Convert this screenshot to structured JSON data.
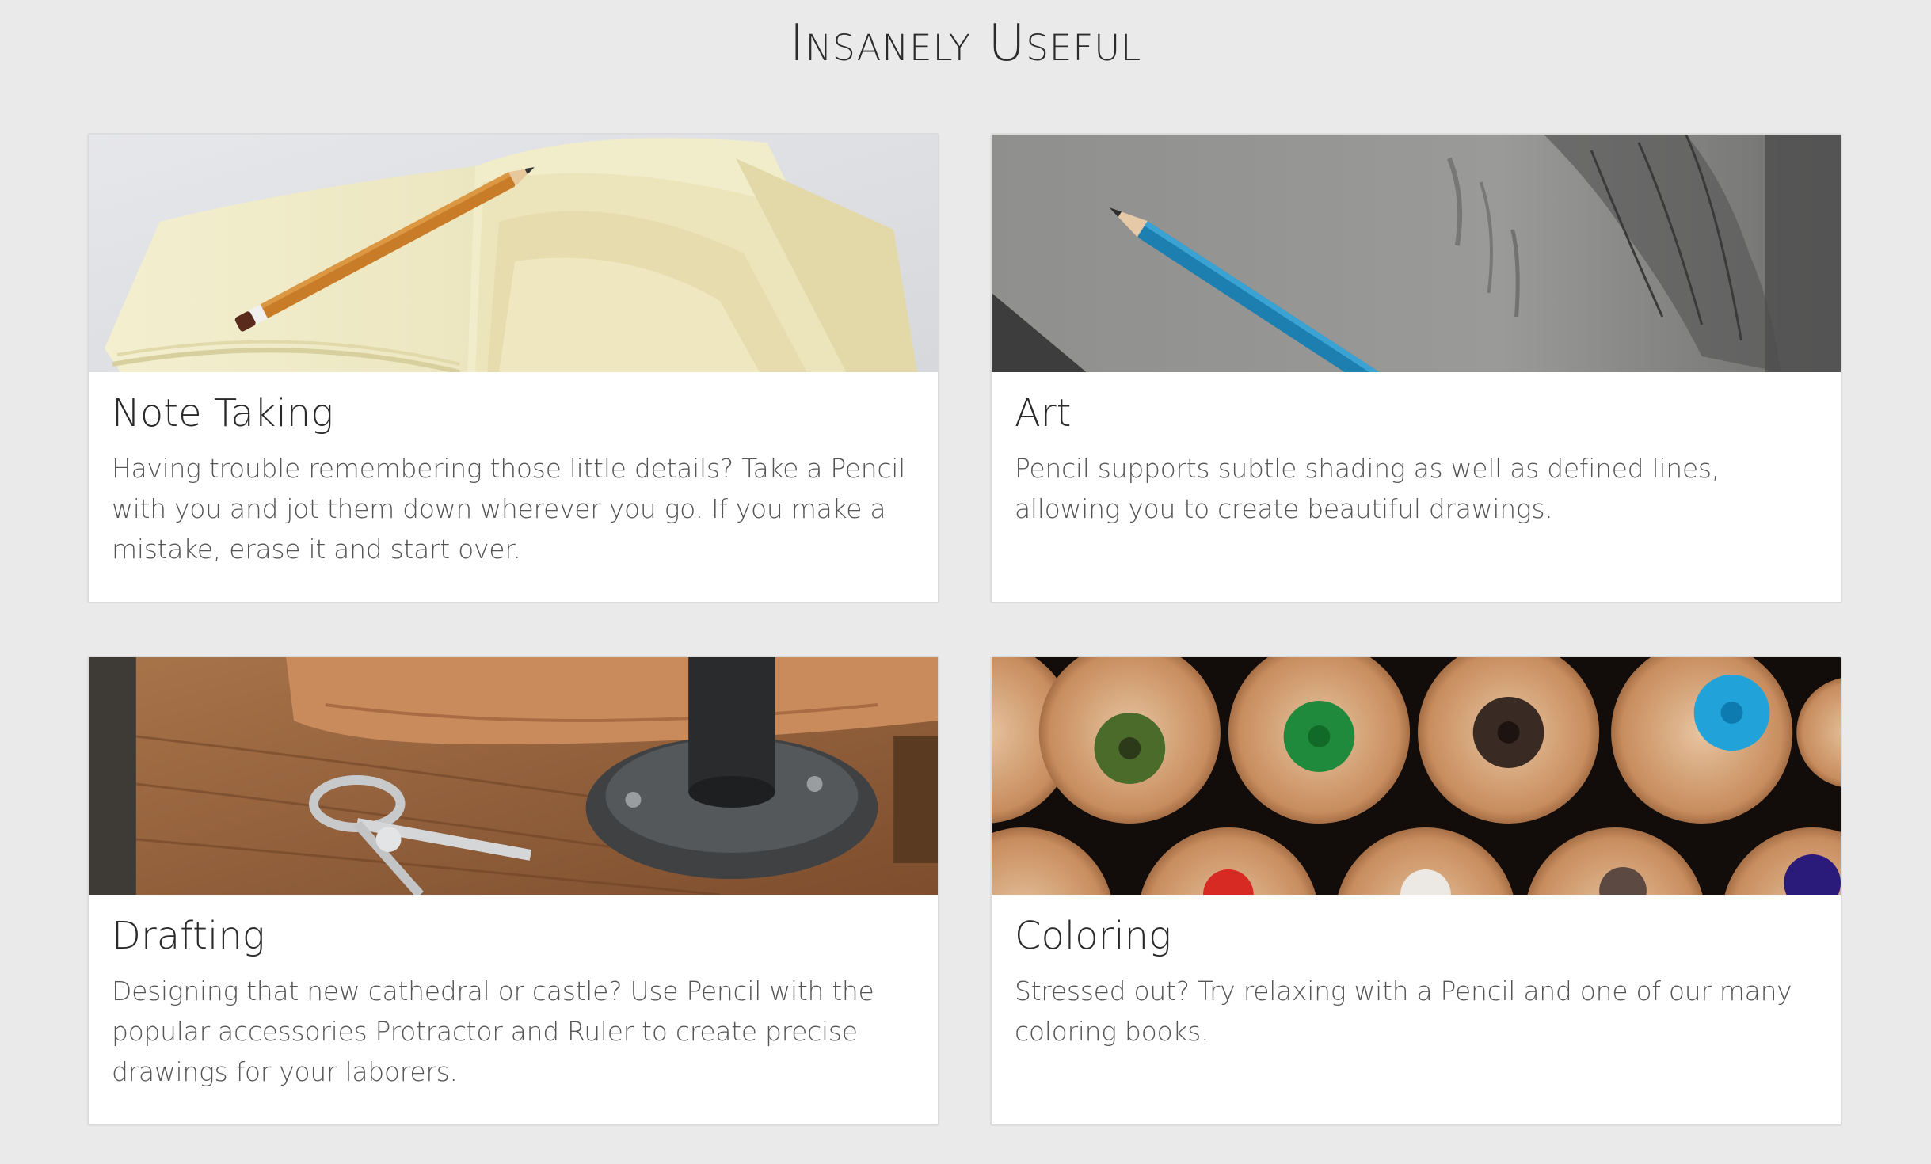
{
  "section": {
    "title": "Insanely Useful"
  },
  "cards": [
    {
      "title": "Note Taking",
      "text": "Having trouble remembering those little details? Take a Pencil with you and jot them down wherever you go. If you make a mistake, erase it and start over.",
      "image_icon": "notebook-pencil-photo"
    },
    {
      "title": "Art",
      "text": "Pencil supports subtle shading as well as defined lines, allowing you to create beautiful drawings.",
      "image_icon": "sketch-pencil-photo"
    },
    {
      "title": "Drafting",
      "text": "Designing that new cathedral or castle? Use Pencil with the popular accessories Protractor and Ruler to create precise drawings for your laborers.",
      "image_icon": "drafting-tools-photo"
    },
    {
      "title": "Coloring",
      "text": "Stressed out? Try relaxing with a Pencil and one of our many coloring books.",
      "image_icon": "colored-pencils-photo"
    }
  ],
  "colors": {
    "page_background": "#eaeaea",
    "card_background": "#ffffff",
    "title_text": "#2a2a2a",
    "body_text": "#555555"
  }
}
